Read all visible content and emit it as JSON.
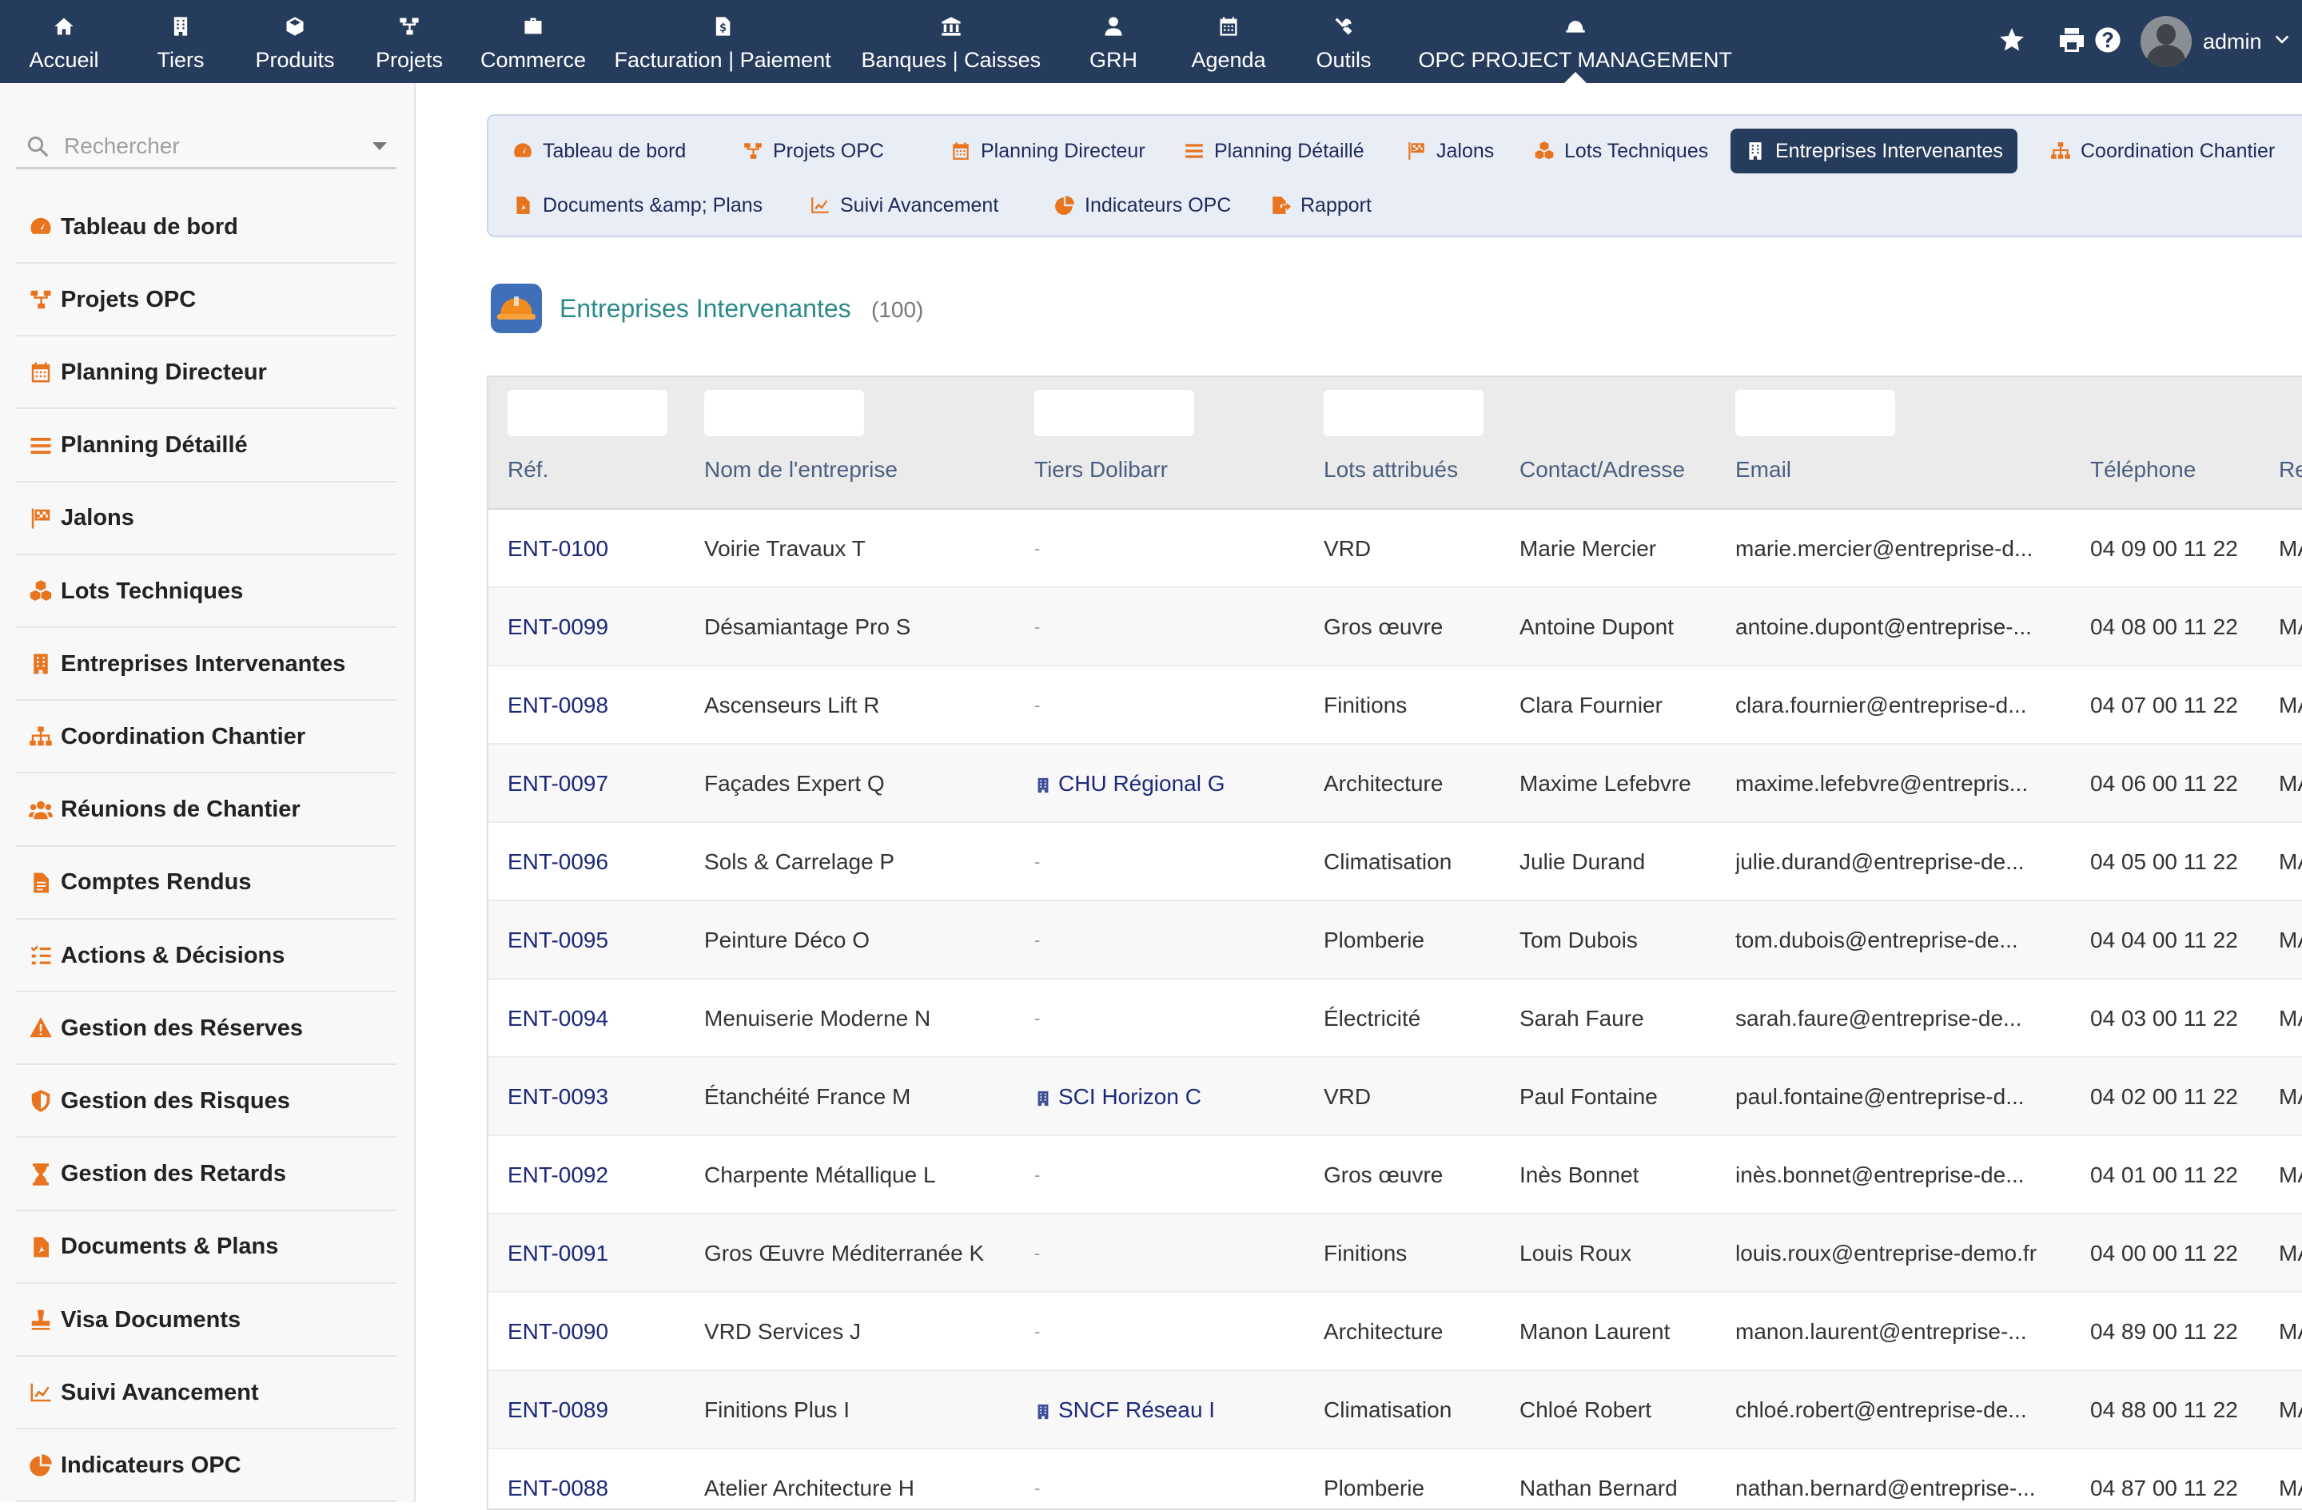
{
  "topnav": {
    "items": [
      {
        "label": "Accueil",
        "icon": "home-icon"
      },
      {
        "label": "Tiers",
        "icon": "building-icon"
      },
      {
        "label": "Produits",
        "icon": "cube-icon"
      },
      {
        "label": "Projets",
        "icon": "sitemap-icon"
      },
      {
        "label": "Commerce",
        "icon": "briefcase-icon"
      },
      {
        "label": "Facturation | Paiement",
        "icon": "invoice-icon"
      },
      {
        "label": "Banques | Caisses",
        "icon": "bank-icon"
      },
      {
        "label": "GRH",
        "icon": "user-tie-icon"
      },
      {
        "label": "Agenda",
        "icon": "calendar-icon"
      },
      {
        "label": "Outils",
        "icon": "tools-icon"
      },
      {
        "label": "OPC PROJECT MANAGEMENT",
        "icon": "hard-hat-icon"
      }
    ],
    "user": "admin"
  },
  "sidebar": {
    "search_placeholder": "Rechercher",
    "items": [
      {
        "label": "Tableau de bord",
        "icon": "dashboard-icon"
      },
      {
        "label": "Projets OPC",
        "icon": "sitemap-icon"
      },
      {
        "label": "Planning Directeur",
        "icon": "calendar-icon"
      },
      {
        "label": "Planning Détaillé",
        "icon": "list-icon"
      },
      {
        "label": "Jalons",
        "icon": "flag-checkered-icon"
      },
      {
        "label": "Lots Techniques",
        "icon": "cubes-icon"
      },
      {
        "label": "Entreprises Intervenantes",
        "icon": "building-icon"
      },
      {
        "label": "Coordination Chantier",
        "icon": "org-chart-icon"
      },
      {
        "label": "Réunions de Chantier",
        "icon": "users-icon"
      },
      {
        "label": "Comptes Rendus",
        "icon": "document-icon"
      },
      {
        "label": "Actions & Décisions",
        "icon": "tasks-icon"
      },
      {
        "label": "Gestion des Réserves",
        "icon": "warning-icon"
      },
      {
        "label": "Gestion des Risques",
        "icon": "shield-icon"
      },
      {
        "label": "Gestion des Retards",
        "icon": "hourglass-icon"
      },
      {
        "label": "Documents & Plans",
        "icon": "pdf-icon"
      },
      {
        "label": "Visa Documents",
        "icon": "stamp-icon"
      },
      {
        "label": "Suivi Avancement",
        "icon": "chart-line-icon"
      },
      {
        "label": "Indicateurs OPC",
        "icon": "chart-pie-icon"
      }
    ]
  },
  "tabs": [
    {
      "label": "Tableau de bord",
      "icon": "dashboard-icon"
    },
    {
      "label": "Projets OPC",
      "icon": "sitemap-icon"
    },
    {
      "label": "Planning Directeur",
      "icon": "calendar-icon"
    },
    {
      "label": "Planning Détaillé",
      "icon": "list-icon"
    },
    {
      "label": "Jalons",
      "icon": "flag-checkered-icon"
    },
    {
      "label": "Lots Techniques",
      "icon": "cubes-icon"
    },
    {
      "label": "Entreprises Intervenantes",
      "icon": "building-icon",
      "active": true
    },
    {
      "label": "Coordination Chantier",
      "icon": "org-chart-icon"
    },
    {
      "label": "Documents &amp; Plans",
      "icon": "pdf-icon"
    },
    {
      "label": "Suivi Avancement",
      "icon": "chart-line-icon"
    },
    {
      "label": "Indicateurs OPC",
      "icon": "chart-pie-icon"
    },
    {
      "label": "Rapport",
      "icon": "export-icon"
    }
  ],
  "page": {
    "title": "Entreprises Intervenantes",
    "count": "(100)"
  },
  "table": {
    "columns": [
      "Réf.",
      "Nom de l'entreprise",
      "Tiers Dolibarr",
      "Lots attribués",
      "Contact/Adresse",
      "Email",
      "Téléphone",
      "Re"
    ],
    "rows": [
      {
        "ref": "ENT-0100",
        "name": "Voirie Travaux T",
        "tiers": "-",
        "lots": "VRD",
        "contact": "Marie Mercier",
        "email": "marie.mercier@entreprise-d...",
        "phone": "04 09 00 11 22",
        "extra": "MA"
      },
      {
        "ref": "ENT-0099",
        "name": "Désamiantage Pro S",
        "tiers": "-",
        "lots": "Gros œuvre",
        "contact": "Antoine Dupont",
        "email": "antoine.dupont@entreprise-...",
        "phone": "04 08 00 11 22",
        "extra": "MA"
      },
      {
        "ref": "ENT-0098",
        "name": "Ascenseurs Lift R",
        "tiers": "-",
        "lots": "Finitions",
        "contact": "Clara Fournier",
        "email": "clara.fournier@entreprise-d...",
        "phone": "04 07 00 11 22",
        "extra": "MA"
      },
      {
        "ref": "ENT-0097",
        "name": "Façades Expert Q",
        "tiers": "CHU Régional G",
        "lots": "Architecture",
        "contact": "Maxime Lefebvre",
        "email": "maxime.lefebvre@entrepris...",
        "phone": "04 06 00 11 22",
        "extra": "MA"
      },
      {
        "ref": "ENT-0096",
        "name": "Sols & Carrelage P",
        "tiers": "-",
        "lots": "Climatisation",
        "contact": "Julie Durand",
        "email": "julie.durand@entreprise-de...",
        "phone": "04 05 00 11 22",
        "extra": "MA"
      },
      {
        "ref": "ENT-0095",
        "name": "Peinture Déco O",
        "tiers": "-",
        "lots": "Plomberie",
        "contact": "Tom Dubois",
        "email": "tom.dubois@entreprise-de...",
        "phone": "04 04 00 11 22",
        "extra": "MA"
      },
      {
        "ref": "ENT-0094",
        "name": "Menuiserie Moderne N",
        "tiers": "-",
        "lots": "Électricité",
        "contact": "Sarah Faure",
        "email": "sarah.faure@entreprise-de...",
        "phone": "04 03 00 11 22",
        "extra": "MA"
      },
      {
        "ref": "ENT-0093",
        "name": "Étanchéité France M",
        "tiers": "SCI Horizon C",
        "lots": "VRD",
        "contact": "Paul Fontaine",
        "email": "paul.fontaine@entreprise-d...",
        "phone": "04 02 00 11 22",
        "extra": "MA"
      },
      {
        "ref": "ENT-0092",
        "name": "Charpente Métallique L",
        "tiers": "-",
        "lots": "Gros œuvre",
        "contact": "Inès Bonnet",
        "email": "inès.bonnet@entreprise-de...",
        "phone": "04 01 00 11 22",
        "extra": "MA"
      },
      {
        "ref": "ENT-0091",
        "name": "Gros Œuvre Méditerranée K",
        "tiers": "-",
        "lots": "Finitions",
        "contact": "Louis Roux",
        "email": "louis.roux@entreprise-demo.fr",
        "phone": "04 00 00 11 22",
        "extra": "MA"
      },
      {
        "ref": "ENT-0090",
        "name": "VRD Services J",
        "tiers": "-",
        "lots": "Architecture",
        "contact": "Manon Laurent",
        "email": "manon.laurent@entreprise-...",
        "phone": "04 89 00 11 22",
        "extra": "MA"
      },
      {
        "ref": "ENT-0089",
        "name": "Finitions Plus I",
        "tiers": "SNCF Réseau I",
        "lots": "Climatisation",
        "contact": "Chloé Robert",
        "email": "chloé.robert@entreprise-de...",
        "phone": "04 88 00 11 22",
        "extra": "MA"
      },
      {
        "ref": "ENT-0088",
        "name": "Atelier Architecture H",
        "tiers": "-",
        "lots": "Plomberie",
        "contact": "Nathan Bernard",
        "email": "nathan.bernard@entreprise-...",
        "phone": "04 87 00 11 22",
        "extra": "MA"
      }
    ]
  }
}
